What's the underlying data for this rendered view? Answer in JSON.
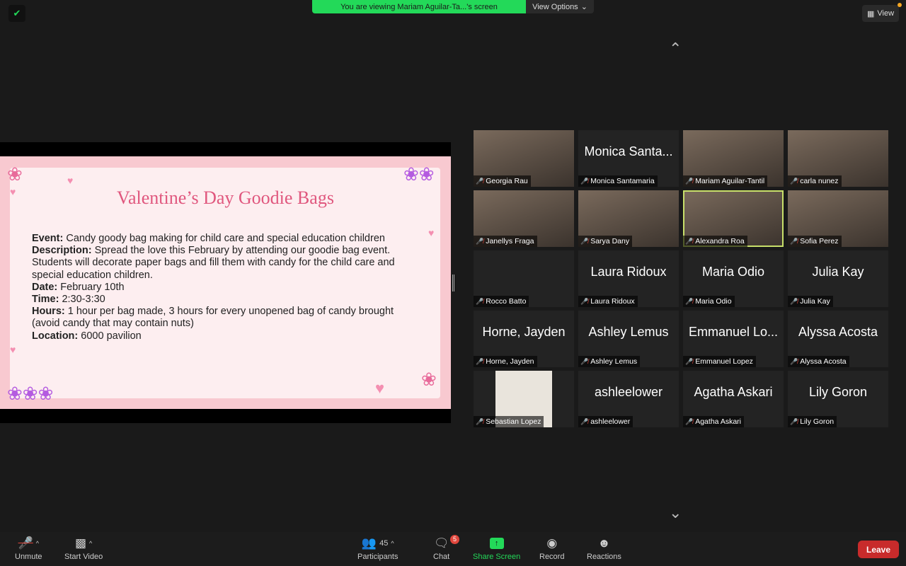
{
  "banner": {
    "message": "You are viewing Mariam Aguilar-Ta...'s screen",
    "view_options": "View Options"
  },
  "view_button": "View",
  "slide": {
    "title": "Valentine’s Day Goodie Bags",
    "fields": [
      {
        "label": "Event:",
        "value": "Candy goody bag making for child care and special education children"
      },
      {
        "label": "Description:",
        "value": "Spread the love this February by attending our goodie bag event. Students will decorate paper bags and fill them with candy for the child care and special education children."
      },
      {
        "label": "Date:",
        "value": "February 10th"
      },
      {
        "label": "Time:",
        "value": "2:30-3:30"
      },
      {
        "label": "Hours:",
        "value": "1 hour per bag made, 3 hours for every unopened bag of candy brought (avoid candy that may contain nuts)"
      },
      {
        "label": "Location:",
        "value": "6000 pavilion"
      }
    ]
  },
  "participants": [
    {
      "name": "Georgia Rau",
      "display": "",
      "video": true
    },
    {
      "name": "Monica Santamaria",
      "display": "Monica Santa...",
      "video": false
    },
    {
      "name": "Mariam Aguilar-Tantil",
      "display": "",
      "video": true
    },
    {
      "name": "carla nunez",
      "display": "",
      "video": true
    },
    {
      "name": "Janellys Fraga",
      "display": "",
      "video": true
    },
    {
      "name": "Sarya Dany",
      "display": "",
      "video": true
    },
    {
      "name": "Alexandra Roa",
      "display": "",
      "video": true,
      "active": true
    },
    {
      "name": "Sofia Perez",
      "display": "",
      "video": true
    },
    {
      "name": "Rocco Batto",
      "display": "",
      "video": false
    },
    {
      "name": "Laura Ridoux",
      "display": "Laura Ridoux",
      "video": false
    },
    {
      "name": "Maria Odio",
      "display": "Maria Odio",
      "video": false
    },
    {
      "name": "Julia Kay",
      "display": "Julia Kay",
      "video": false
    },
    {
      "name": "Horne, Jayden",
      "display": "Horne, Jayden",
      "video": false
    },
    {
      "name": "Ashley Lemus",
      "display": "Ashley Lemus",
      "video": false
    },
    {
      "name": "Emmanuel Lopez",
      "display": "Emmanuel Lo...",
      "video": false
    },
    {
      "name": "Alyssa Acosta",
      "display": "Alyssa Acosta",
      "video": false
    },
    {
      "name": "Sebastian Lopez",
      "display": "",
      "video": true
    },
    {
      "name": "ashleelower",
      "display": "ashleelower",
      "video": false
    },
    {
      "name": "Agatha Askari",
      "display": "Agatha Askari",
      "video": false
    },
    {
      "name": "Lily Goron",
      "display": "Lily Goron",
      "video": false
    }
  ],
  "toolbar": {
    "unmute": "Unmute",
    "start_video": "Start Video",
    "participants": "Participants",
    "participant_count": "45",
    "chat": "Chat",
    "chat_badge": "5",
    "share_screen": "Share Screen",
    "record": "Record",
    "reactions": "Reactions",
    "leave": "Leave"
  },
  "colors": {
    "accent_green": "#23d959",
    "leave_red": "#c82b2b",
    "active_speaker": "#c8e06a",
    "slide_title": "#e0577e"
  }
}
